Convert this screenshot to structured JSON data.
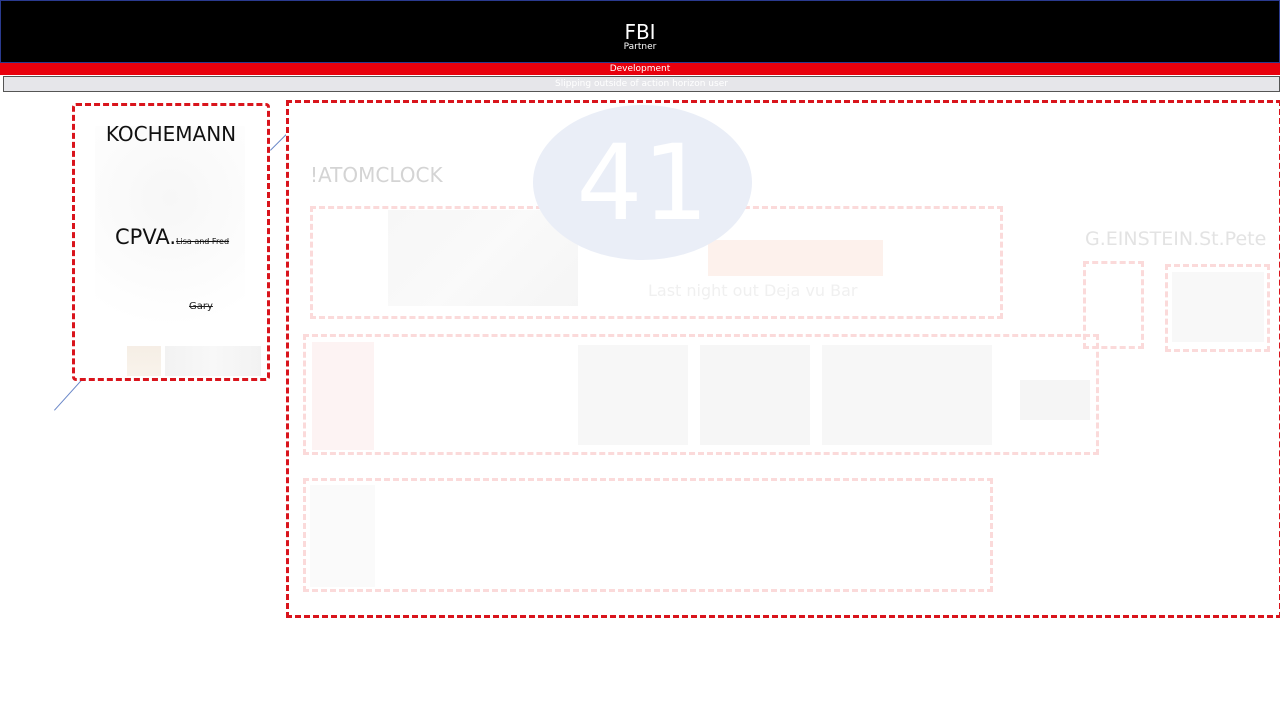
{
  "header": {
    "title": "FBI",
    "subtitle": "Partner"
  },
  "red_bar": {
    "label": "Development"
  },
  "grey_bar": {
    "label": "Slipping outside of action horizon user"
  },
  "left_card": {
    "title": "KOCHEMANN",
    "main_label": "CPVA.",
    "struck_label": "Lisa and Fred",
    "struck_name": "Gary"
  },
  "main_card": {
    "badge_number": "41",
    "section_title": "!ATOMCLOCK",
    "side_title": "G.EINSTEIN.St.Pete",
    "faded_caption": "Last night out Deja vu Bar"
  },
  "colors": {
    "accent_red": "#d9141c",
    "header_black": "#000000",
    "badge_blue": "#eaeef7"
  }
}
